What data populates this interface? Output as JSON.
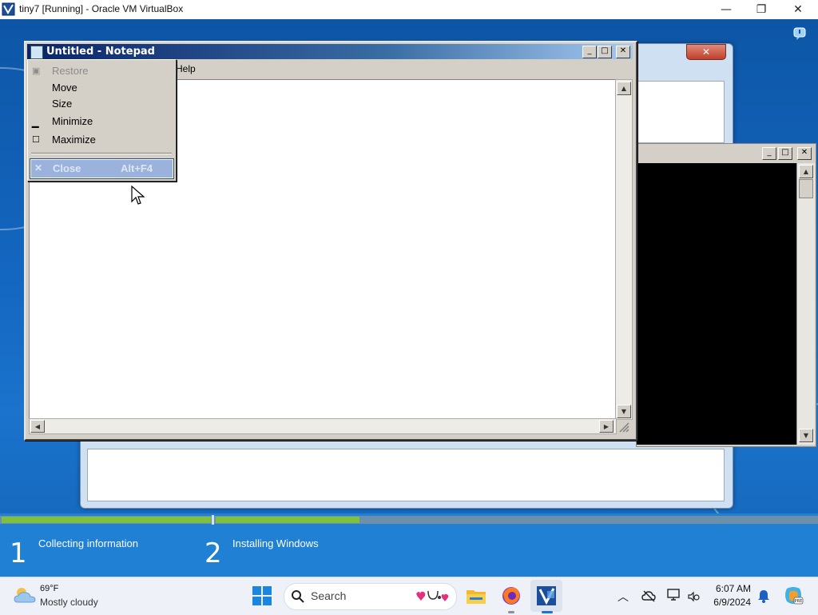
{
  "host": {
    "window_title": "tiny7 [Running] - Oracle VM VirtualBox",
    "minimize_glyph": "—",
    "restore_glyph": "❐",
    "close_glyph": "✕"
  },
  "notepad": {
    "title": "Untitled - Notepad",
    "menu_help": "Help"
  },
  "system_menu": {
    "items": [
      {
        "label": "Restore",
        "enabled": false
      },
      {
        "label": "Move",
        "enabled": true
      },
      {
        "label": "Size",
        "enabled": true
      },
      {
        "label": "Minimize",
        "enabled": true
      },
      {
        "label": "Maximize",
        "enabled": true
      }
    ],
    "close": {
      "label": "Close",
      "accelerator": "Alt+F4",
      "highlighted": true
    }
  },
  "setup": {
    "steps": [
      {
        "number": "1",
        "label": "Collecting information"
      },
      {
        "number": "2",
        "label": "Installing Windows"
      }
    ],
    "progress": {
      "segment1_complete": 1.0,
      "segment2_complete": 0.24
    }
  },
  "taskbar": {
    "weather": {
      "temperature": "69°F",
      "condition": "Mostly cloudy",
      "icon": "cloud-sun-icon"
    },
    "search_placeholder": "Search",
    "clock": {
      "time": "6:07 AM",
      "date": "6/9/2024"
    }
  },
  "colors": {
    "notepad_titlebar": "#0a246a",
    "menu_highlight": "#9ab2dc",
    "progress_green": "#80c040",
    "desktop_blue": "#1466c0"
  }
}
